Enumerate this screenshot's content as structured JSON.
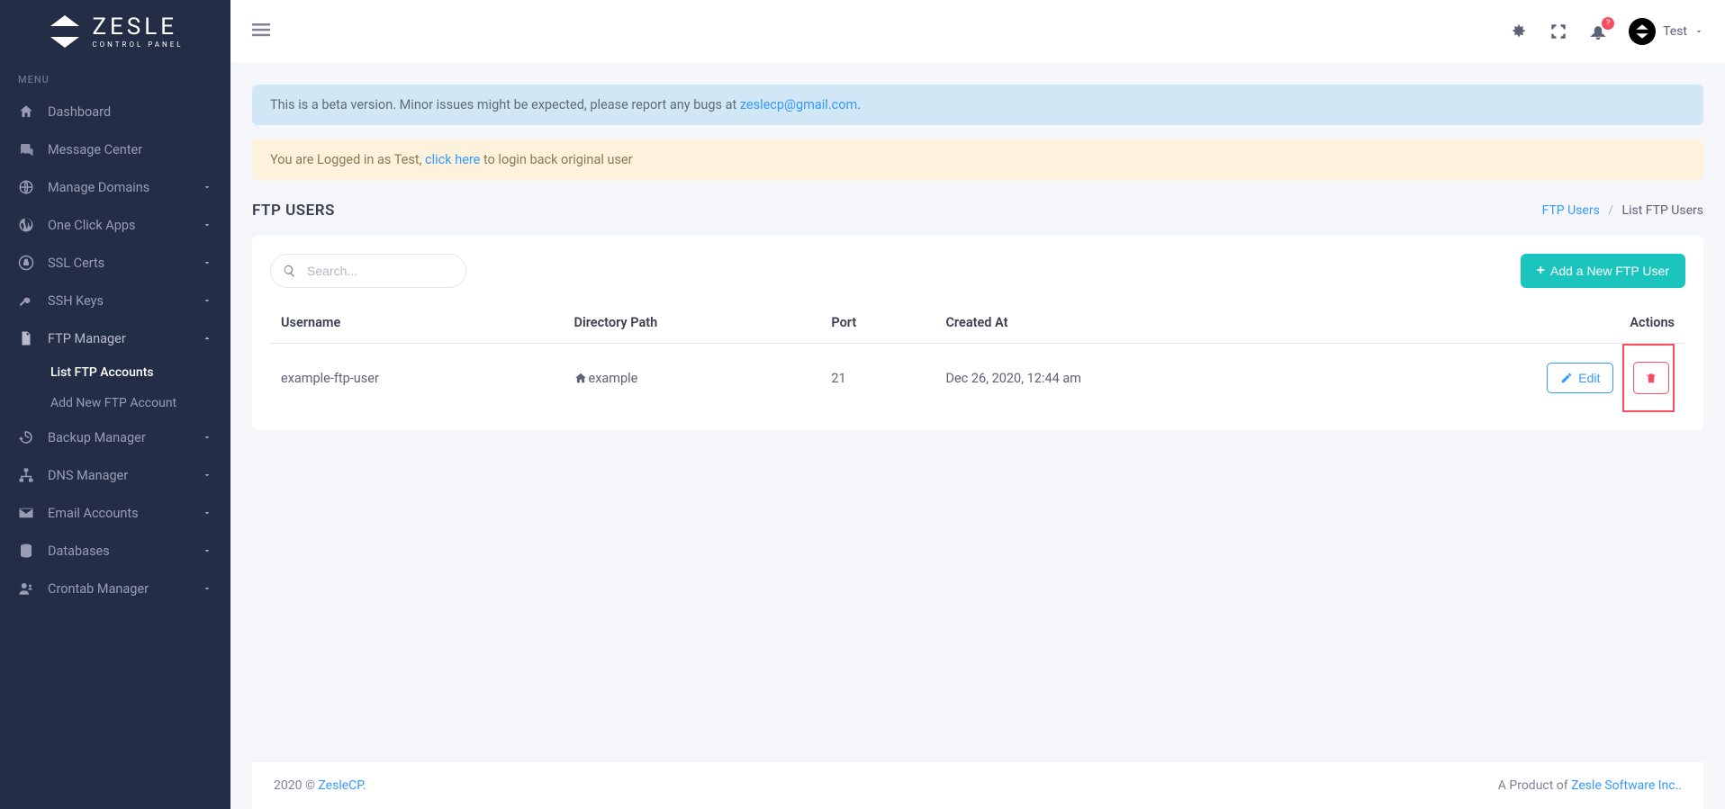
{
  "logo": {
    "title": "ZESLE",
    "subtitle": "CONTROL PANEL"
  },
  "sidebar": {
    "section": "MENU",
    "items": [
      {
        "label": "Dashboard",
        "chevron": false
      },
      {
        "label": "Message Center",
        "chevron": false
      },
      {
        "label": "Manage Domains",
        "chevron": true
      },
      {
        "label": "One Click Apps",
        "chevron": true
      },
      {
        "label": "SSL Certs",
        "chevron": true
      },
      {
        "label": "SSH Keys",
        "chevron": true
      },
      {
        "label": "FTP Manager",
        "chevron": true,
        "expanded": true,
        "sub": [
          {
            "label": "List FTP Accounts",
            "active": true
          },
          {
            "label": "Add New FTP Account",
            "active": false
          }
        ]
      },
      {
        "label": "Backup Manager",
        "chevron": true
      },
      {
        "label": "DNS Manager",
        "chevron": true
      },
      {
        "label": "Email Accounts",
        "chevron": true
      },
      {
        "label": "Databases",
        "chevron": true
      },
      {
        "label": "Crontab Manager",
        "chevron": true
      }
    ]
  },
  "topbar": {
    "bell_badge": "?",
    "user_name": "Test"
  },
  "alerts": {
    "beta_prefix": "This is a beta version. Minor issues might be expected, please report any bugs at ",
    "beta_email": "zeslecp@gmail.com",
    "beta_suffix": ".",
    "login_prefix": "You are Logged in as Test, ",
    "login_link": "click here",
    "login_suffix": " to login back original user"
  },
  "page": {
    "title": "FTP USERS",
    "breadcrumb_root": "FTP Users",
    "breadcrumb_current": "List FTP Users"
  },
  "search": {
    "placeholder": "Search..."
  },
  "buttons": {
    "add": "Add a New FTP User",
    "edit": "Edit"
  },
  "table": {
    "headers": {
      "username": "Username",
      "path": "Directory Path",
      "port": "Port",
      "created": "Created At",
      "actions": "Actions"
    },
    "rows": [
      {
        "username": "example-ftp-user",
        "path": "example",
        "port": "21",
        "created": "Dec 26, 2020, 12:44 am"
      }
    ]
  },
  "footer": {
    "copyright_prefix": "2020 © ",
    "copyright_link": "ZesleCP",
    "copyright_suffix": ".",
    "product_prefix": "A Product of ",
    "product_link": "Zesle Software Inc.",
    "product_suffix": "."
  }
}
